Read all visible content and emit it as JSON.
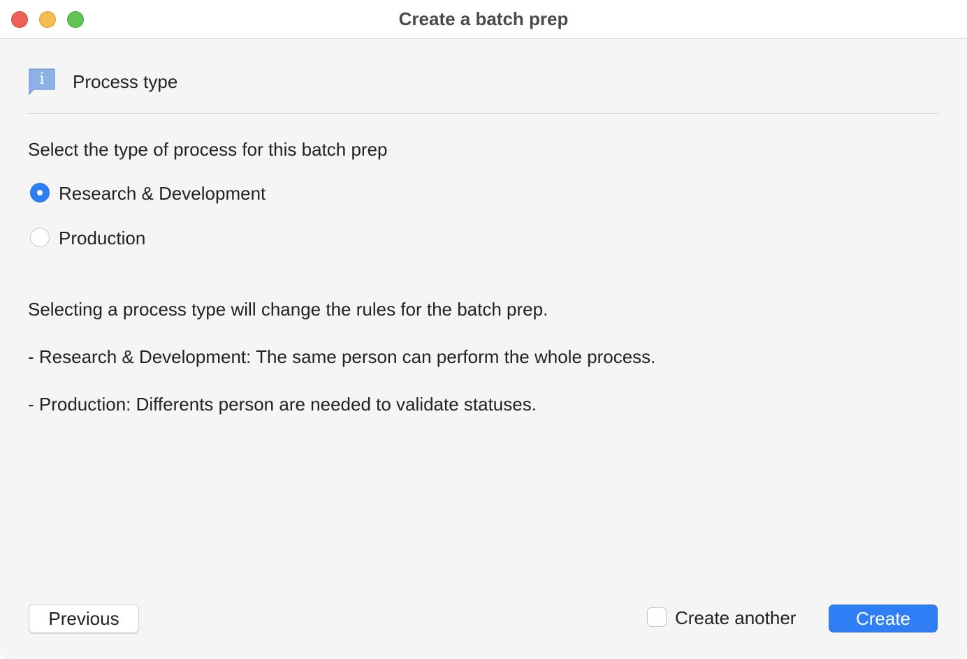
{
  "window": {
    "title": "Create a batch prep"
  },
  "section": {
    "icon": "info-bubble-icon",
    "title": "Process type"
  },
  "form": {
    "prompt": "Select the type of process for this batch prep",
    "options": [
      {
        "label": "Research & Development",
        "selected": true
      },
      {
        "label": "Production",
        "selected": false
      }
    ]
  },
  "description": {
    "line1": "Selecting a process type will change the rules for the batch prep.",
    "line2": "- Research & Development: The same person can perform the whole process.",
    "line3": "- Production: Differents person are needed to validate statuses."
  },
  "footer": {
    "previous_label": "Previous",
    "create_another_label": "Create another",
    "create_another_checked": false,
    "create_label": "Create"
  },
  "colors": {
    "accent": "#2f7ef6",
    "close": "#ee5f57",
    "minimize": "#f4bd4f",
    "zoom": "#5fc454",
    "info_icon": "#8eb2e8"
  }
}
